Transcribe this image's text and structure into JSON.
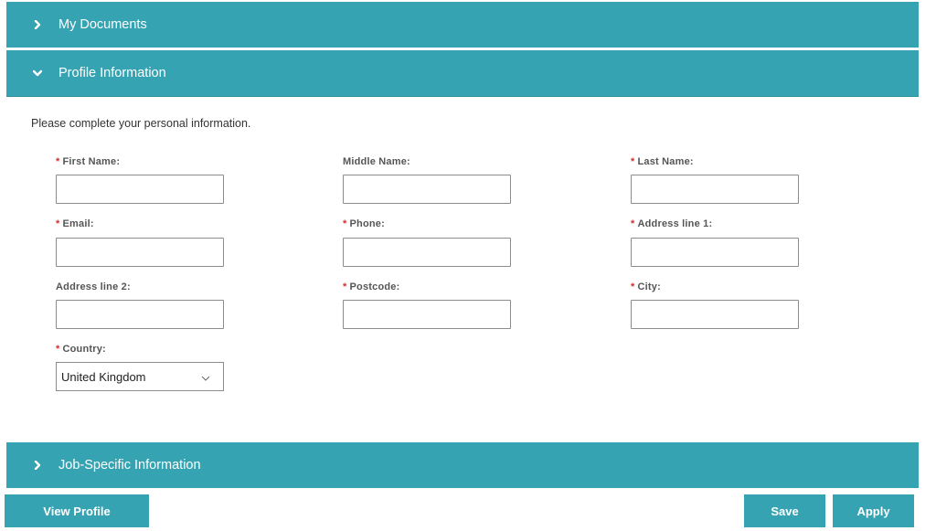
{
  "sections": {
    "documents": {
      "title": "My Documents"
    },
    "profile": {
      "title": "Profile Information"
    },
    "job": {
      "title": "Job-Specific Information"
    }
  },
  "profile": {
    "intro": "Please complete your personal information.",
    "required_mark": "*",
    "fields": {
      "first_name": {
        "label": "First Name:",
        "value": ""
      },
      "middle_name": {
        "label": "Middle Name:",
        "value": ""
      },
      "last_name": {
        "label": "Last Name:",
        "value": ""
      },
      "email": {
        "label": "Email:",
        "value": ""
      },
      "phone": {
        "label": "Phone:",
        "value": ""
      },
      "address1": {
        "label": "Address line 1:",
        "value": ""
      },
      "address2": {
        "label": "Address line 2:",
        "value": ""
      },
      "postcode": {
        "label": "Postcode:",
        "value": ""
      },
      "city": {
        "label": "City:",
        "value": ""
      },
      "country": {
        "label": "Country:",
        "value": "United Kingdom"
      }
    }
  },
  "actions": {
    "view_profile": "View Profile",
    "save": "Save",
    "apply": "Apply"
  },
  "colors": {
    "accent": "#35a3b2",
    "required": "#d32f2f"
  }
}
